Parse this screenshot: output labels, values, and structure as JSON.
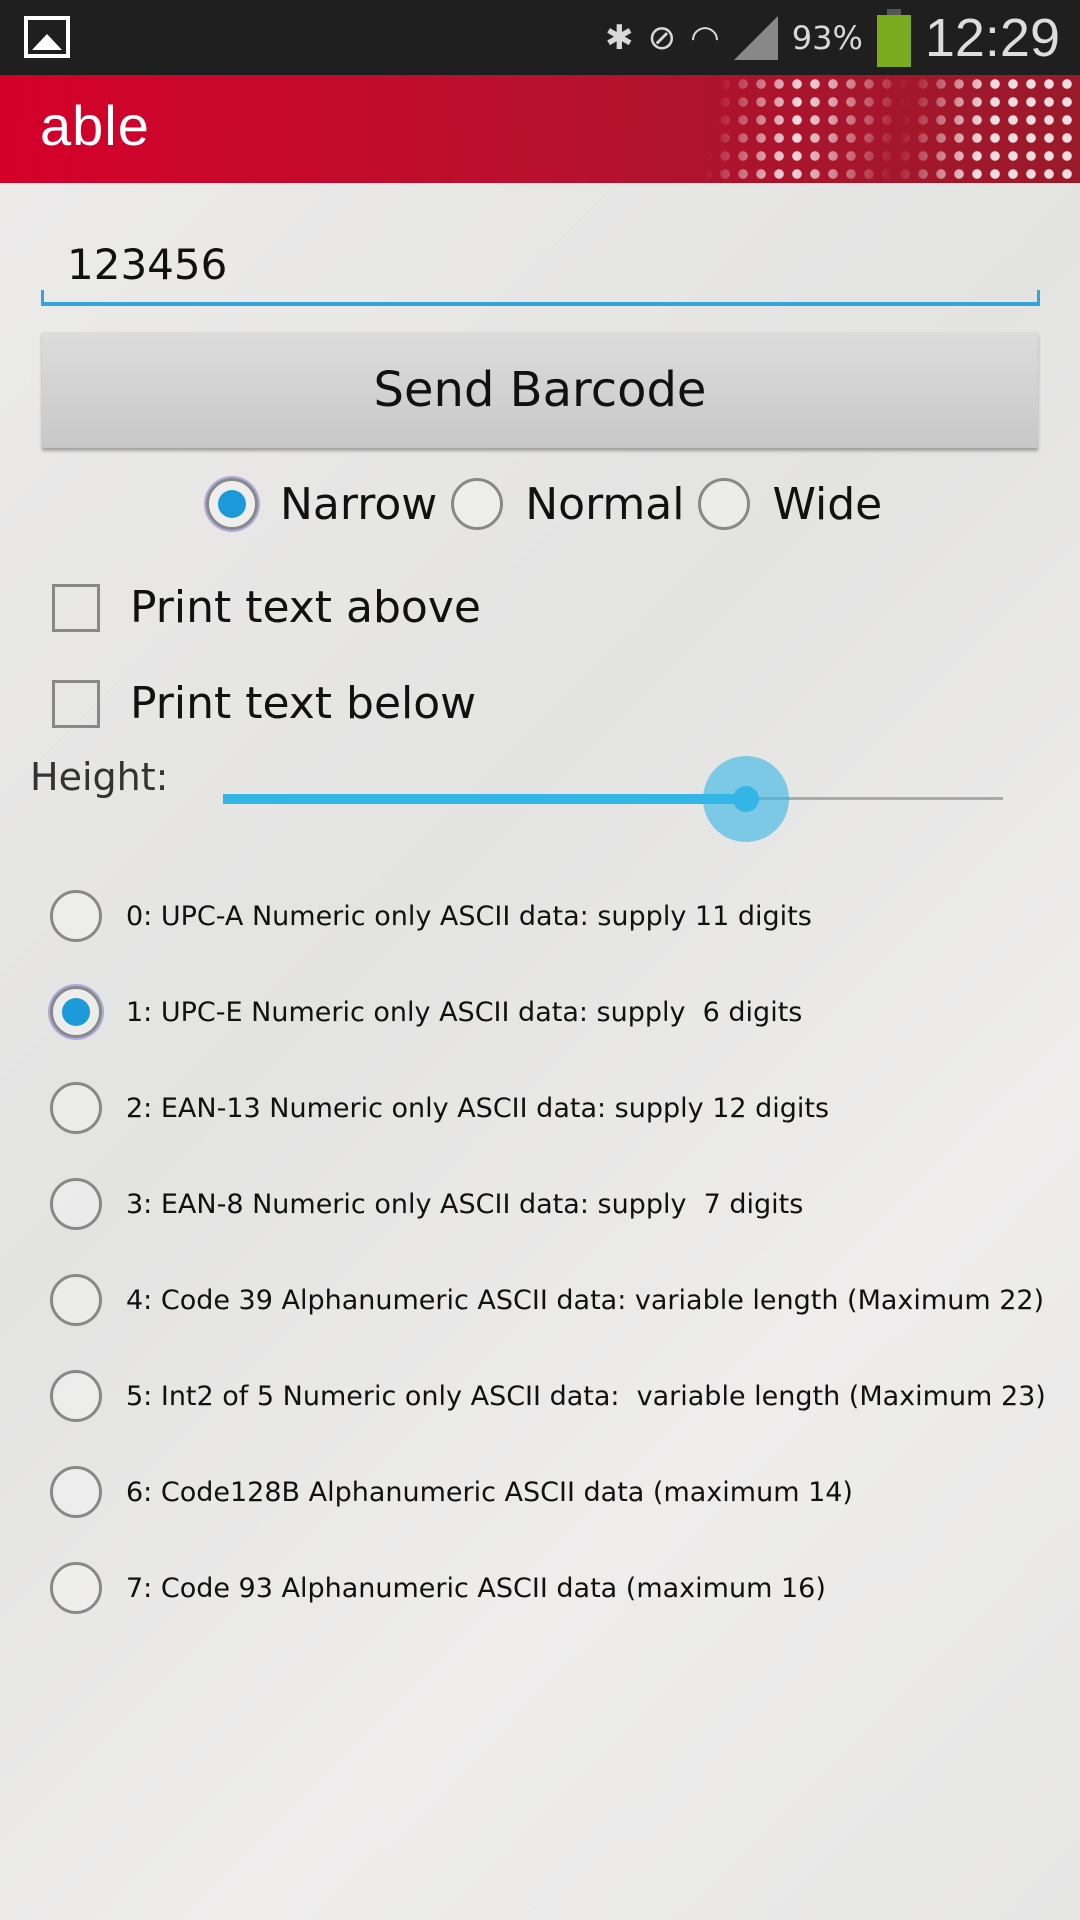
{
  "status_bar": {
    "battery": "93%",
    "time": "12:29",
    "icons": [
      "gallery-icon",
      "bluetooth-icon",
      "mute-vibrate-icon",
      "wifi-icon",
      "signal-icon",
      "battery-icon"
    ]
  },
  "header": {
    "logo": "able",
    "color": "#d5002a"
  },
  "barcode_input": {
    "value": "123456"
  },
  "send_button": {
    "label": "Send Barcode"
  },
  "width_options": [
    {
      "label": "Narrow",
      "selected": true
    },
    {
      "label": "Normal",
      "selected": false
    },
    {
      "label": "Wide",
      "selected": false
    }
  ],
  "checkboxes": [
    {
      "label": "Print text above",
      "checked": false
    },
    {
      "label": "Print text below",
      "checked": false
    }
  ],
  "height": {
    "label": "Height:",
    "value_fraction": 0.67
  },
  "barcode_types": [
    {
      "label": "0: UPC-A Numeric only ASCII data: supply 11 digits",
      "selected": false
    },
    {
      "label": "1: UPC-E Numeric only ASCII data: supply  6 digits",
      "selected": true
    },
    {
      "label": "2: EAN-13 Numeric only ASCII data: supply 12 digits",
      "selected": false
    },
    {
      "label": "3: EAN-8 Numeric only ASCII data: supply  7 digits",
      "selected": false
    },
    {
      "label": "4: Code 39 Alphanumeric ASCII data: variable length (Maximum 22)",
      "selected": false
    },
    {
      "label": "5: Int2 of 5 Numeric only ASCII data:  variable length (Maximum 23)",
      "selected": false
    },
    {
      "label": "6: Code128B Alphanumeric ASCII data (maximum 14)",
      "selected": false
    },
    {
      "label": "7: Code 93 Alphanumeric ASCII data (maximum 16)",
      "selected": false
    }
  ],
  "accent": "#33b5e5"
}
